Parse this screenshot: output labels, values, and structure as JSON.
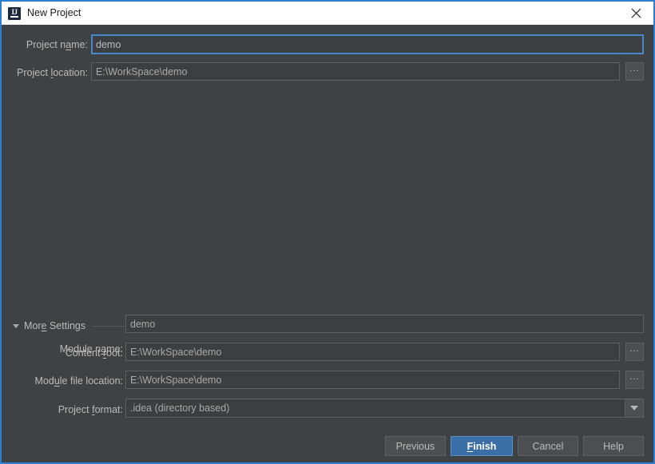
{
  "window": {
    "title": "New Project",
    "app_icon": "intellij-idea-icon",
    "close_icon": "close-icon",
    "accent_color": "#2d7dd2",
    "background_color": "#3f4244",
    "titlebar_background": "#ffffff"
  },
  "main_form": {
    "project_name": {
      "label_before": "Project n",
      "label_mnemonic": "a",
      "label_after": "me:",
      "label_full": "Project name:",
      "value": "demo",
      "focused": true
    },
    "project_location": {
      "label_before": "Project ",
      "label_mnemonic": "l",
      "label_after": "ocation:",
      "label_full": "Project location:",
      "value": "E:\\WorkSpace\\demo",
      "browse_icon": "ellipsis-icon",
      "browse_label": "..."
    }
  },
  "more_settings": {
    "header_before": "Mor",
    "header_mnemonic": "e",
    "header_after": " Settings",
    "header_full": "More Settings",
    "expanded": true,
    "toggle_icon": "triangle-down-icon",
    "module_name": {
      "label_before": "Module n",
      "label_mnemonic": "a",
      "label_after": "me:",
      "label_full": "Module name:",
      "value": "demo"
    },
    "content_root": {
      "label_before": "Content ",
      "label_mnemonic": "r",
      "label_after": "oot:",
      "label_full": "Content root:",
      "value": "E:\\WorkSpace\\demo",
      "browse_label": "..."
    },
    "module_file_location": {
      "label_before": "Mod",
      "label_mnemonic": "u",
      "label_after": "le file location:",
      "label_full": "Module file location:",
      "value": "E:\\WorkSpace\\demo",
      "browse_label": "..."
    },
    "project_format": {
      "label_before": "Project ",
      "label_mnemonic": "f",
      "label_after": "ormat:",
      "label_full": "Project format:",
      "value": ".idea (directory based)",
      "arrow_icon": "chevron-down-icon"
    }
  },
  "footer": {
    "previous": "Previous",
    "finish_before": "",
    "finish_mnemonic": "F",
    "finish_after": "inish",
    "finish_full": "Finish",
    "cancel": "Cancel",
    "help": "Help",
    "primary_color": "#3c6ea6"
  }
}
